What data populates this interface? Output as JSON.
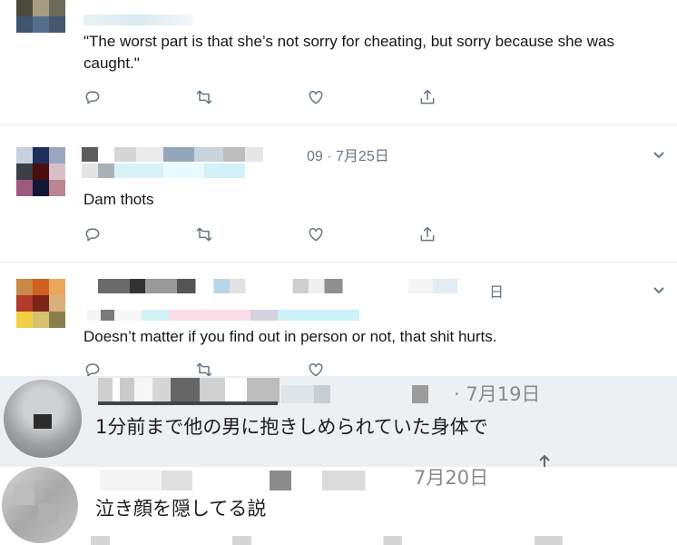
{
  "tweets": [
    {
      "text": "\"The worst part is that she’s not sorry for cheating, but sorry because she was caught.\"",
      "date": ""
    },
    {
      "date": "09 · 7月25日",
      "text": "Dam thots"
    },
    {
      "date": "日",
      "text": "Doesn’t matter if you find out in person or not, that shit hurts."
    }
  ],
  "overlay_comments": [
    {
      "date": "· 7月19日",
      "text": "1分前まで他の男に抱きしめられていた身体で"
    },
    {
      "date": "7月20日",
      "text": "泣き顔を隠してる説"
    }
  ],
  "icons": {
    "reply": "reply-icon",
    "retweet": "retweet-icon",
    "like": "heart-icon",
    "share": "share-icon",
    "more": "chevron-down-icon"
  },
  "colors": {
    "text": "#14171a",
    "muted": "#657786",
    "border": "#e6ecf0",
    "overlay_bg": "#eef1f4"
  }
}
